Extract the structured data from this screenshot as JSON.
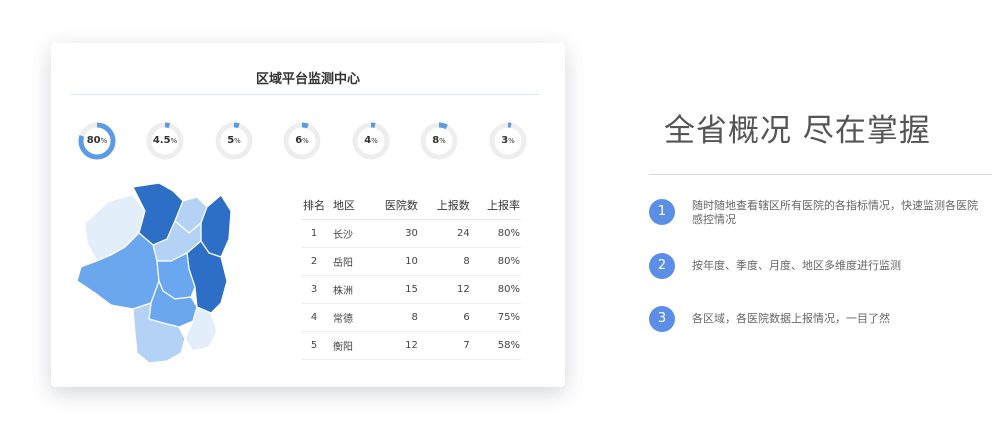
{
  "panel": {
    "title": "区域平台监测中心",
    "gauges": [
      {
        "value": "80",
        "unit": "%",
        "fraction": 0.8
      },
      {
        "value": "4.5",
        "unit": "%",
        "fraction": 0.045
      },
      {
        "value": "5",
        "unit": "%",
        "fraction": 0.05
      },
      {
        "value": "6",
        "unit": "%",
        "fraction": 0.06
      },
      {
        "value": "4",
        "unit": "%",
        "fraction": 0.04
      },
      {
        "value": "8",
        "unit": "%",
        "fraction": 0.08
      },
      {
        "value": "3",
        "unit": "%",
        "fraction": 0.03
      }
    ],
    "table": {
      "headers": [
        "排名",
        "地区",
        "医院数",
        "上报数",
        "上报率"
      ],
      "rows": [
        [
          "1",
          "长沙",
          "30",
          "24",
          "80%"
        ],
        [
          "2",
          "岳阳",
          "10",
          "8",
          "80%"
        ],
        [
          "3",
          "株洲",
          "15",
          "12",
          "80%"
        ],
        [
          "4",
          "常德",
          "8",
          "6",
          "75%"
        ],
        [
          "5",
          "衡阳",
          "12",
          "7",
          "58%"
        ]
      ]
    }
  },
  "headline": "全省概况 尽在掌握",
  "features": [
    {
      "num": "1",
      "text": "随时随地查看辖区所有医院的各指标情况，快速监测各医院感控情况"
    },
    {
      "num": "2",
      "text": "按年度、季度、月度、地区多维度进行监测"
    },
    {
      "num": "3",
      "text": "各区域，各医院数据上报情况，一目了然"
    }
  ],
  "colors": {
    "gauge_fill": "#5b9be6",
    "gauge_track": "#eeeeee",
    "feature_badge": "#5b8fe7",
    "map_dark": "#2d6fc7",
    "map_mid": "#6aa7ee",
    "map_light": "#b3d2f6",
    "map_pale": "#e3eefb"
  }
}
